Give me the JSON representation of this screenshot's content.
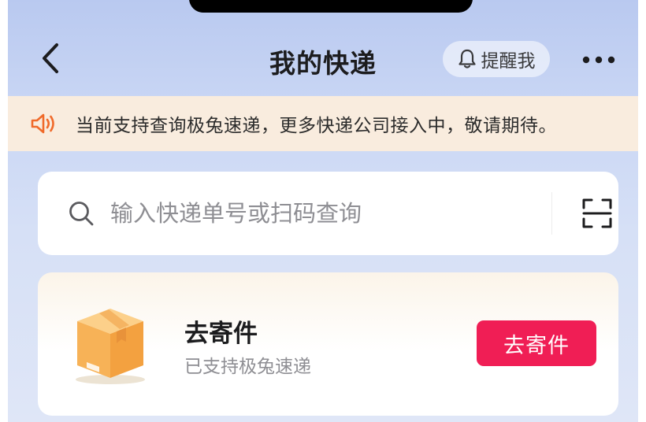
{
  "header": {
    "title": "我的快递",
    "remind_label": "提醒我"
  },
  "notice": {
    "text": "当前支持查询极兔速递，更多快递公司接入中，敬请期待。"
  },
  "search": {
    "placeholder": "输入快递单号或扫码查询"
  },
  "send_card": {
    "title": "去寄件",
    "subtitle": "已支持极兔速递",
    "button_label": "去寄件"
  },
  "colors": {
    "accent": "#f01e55",
    "notice_bg": "#f9ecde",
    "notice_icon": "#f06a2a"
  },
  "icons": {
    "back": "chevron-left-icon",
    "bell": "bell-icon",
    "more": "more-dots-icon",
    "speaker": "speaker-icon",
    "search": "search-icon",
    "scan": "scan-icon",
    "package": "package-box-icon"
  }
}
